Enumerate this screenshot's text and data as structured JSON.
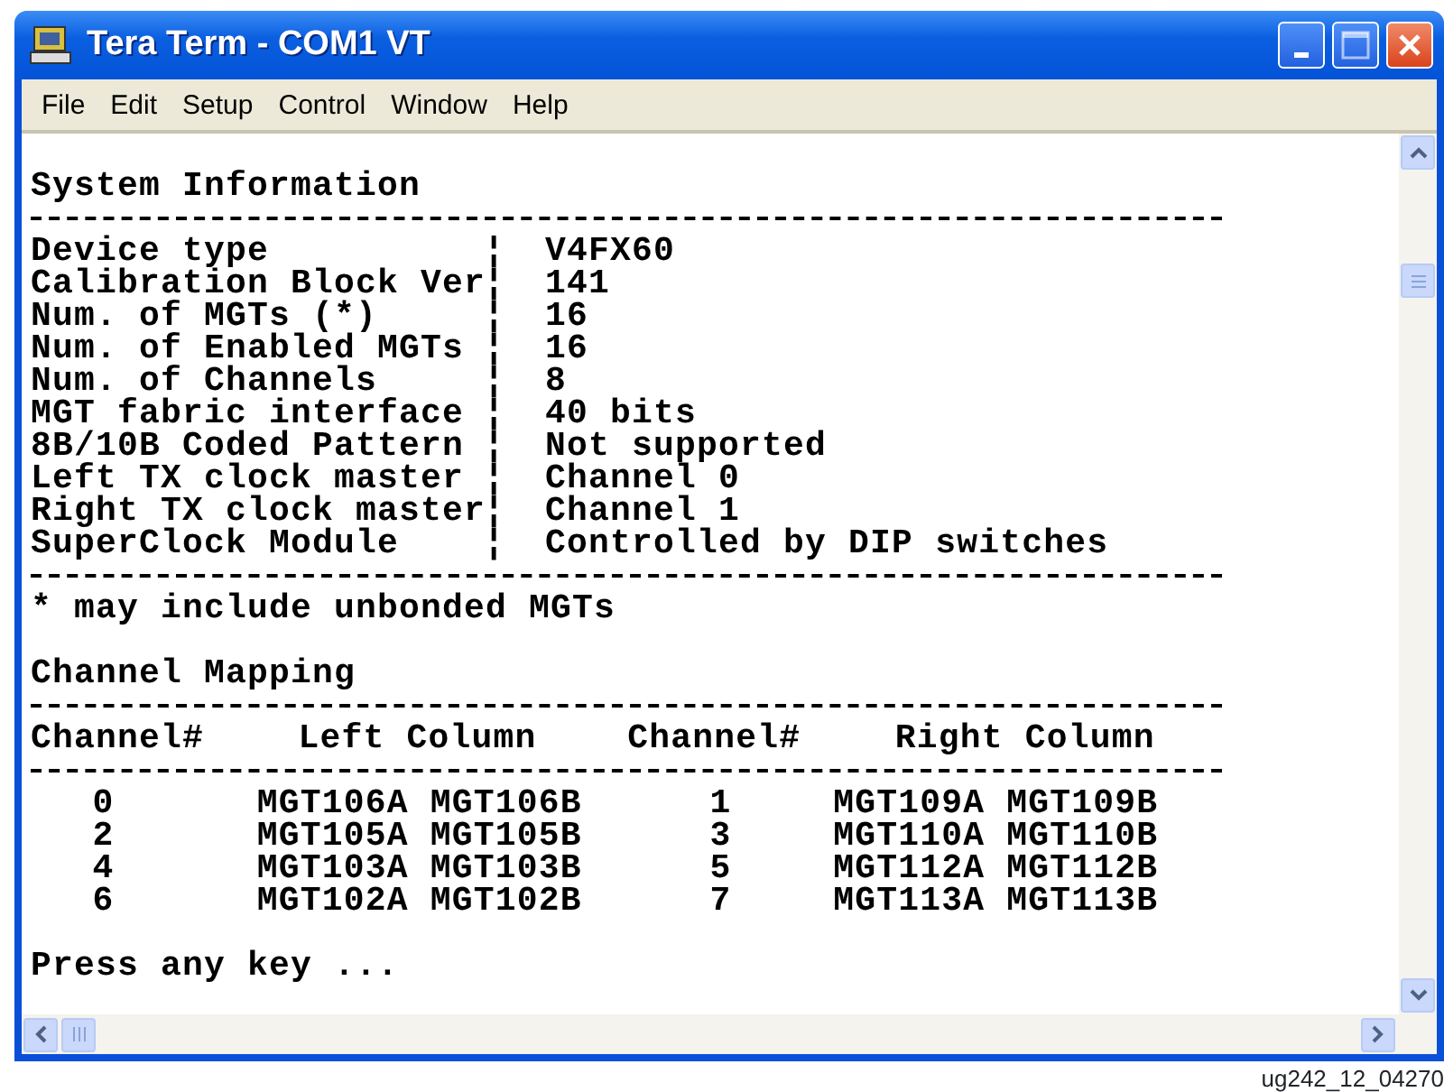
{
  "window": {
    "title": "Tera Term - COM1 VT"
  },
  "menu": [
    "File",
    "Edit",
    "Setup",
    "Control",
    "Window",
    "Help"
  ],
  "terminal": {
    "heading": "System Information",
    "info": [
      {
        "label": "Device type",
        "value": "V4FX60"
      },
      {
        "label": "Calibration Block Ver",
        "value": "141"
      },
      {
        "label": "Num. of MGTs (*)",
        "value": "16"
      },
      {
        "label": "Num. of Enabled MGTs",
        "value": "16"
      },
      {
        "label": "Num. of Channels",
        "value": "8"
      },
      {
        "label": "MGT fabric interface",
        "value": "40 bits"
      },
      {
        "label": "8B/10B Coded Pattern",
        "value": "Not supported"
      },
      {
        "label": "Left TX clock master",
        "value": "Channel 0"
      },
      {
        "label": "Right TX clock master",
        "value": "Channel 1"
      },
      {
        "label": "SuperClock Module",
        "value": "Controlled by DIP switches"
      }
    ],
    "separator": "¦",
    "footnote": "* may include unbonded MGTs",
    "mapping_heading": "Channel Mapping",
    "columns": [
      "Channel#",
      "Left Column",
      "Channel#",
      "Right Column"
    ],
    "rows": [
      [
        "0",
        "MGT106A MGT106B",
        "1",
        "MGT109A MGT109B"
      ],
      [
        "2",
        "MGT105A MGT105B",
        "3",
        "MGT110A MGT110B"
      ],
      [
        "4",
        "MGT103A MGT103B",
        "5",
        "MGT112A MGT112B"
      ],
      [
        "6",
        "MGT102A MGT102B",
        "7",
        "MGT113A MGT113B"
      ]
    ],
    "prompt": "Press any key ..."
  },
  "caption": "ug242_12_04270"
}
